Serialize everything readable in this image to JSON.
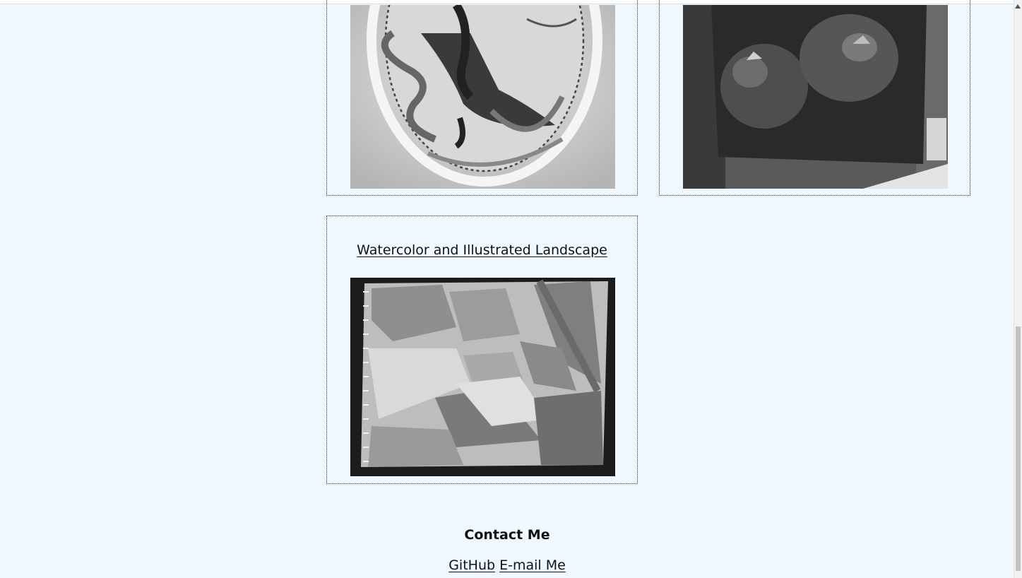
{
  "gallery": {
    "items": [
      {
        "title": "",
        "image_icon": "embroidery-bird-image"
      },
      {
        "title": "",
        "image_icon": "pomegranate-painting-image"
      },
      {
        "title": "Watercolor and Illustrated Landscape",
        "image_icon": "watercolor-landscape-image"
      }
    ]
  },
  "contact": {
    "heading": "Contact Me",
    "links": [
      {
        "label": "GitHub"
      },
      {
        "label": "E-mail Me"
      }
    ]
  },
  "colors": {
    "page_background": "#f0f8ff",
    "border": "#333333",
    "text": "#111111"
  }
}
